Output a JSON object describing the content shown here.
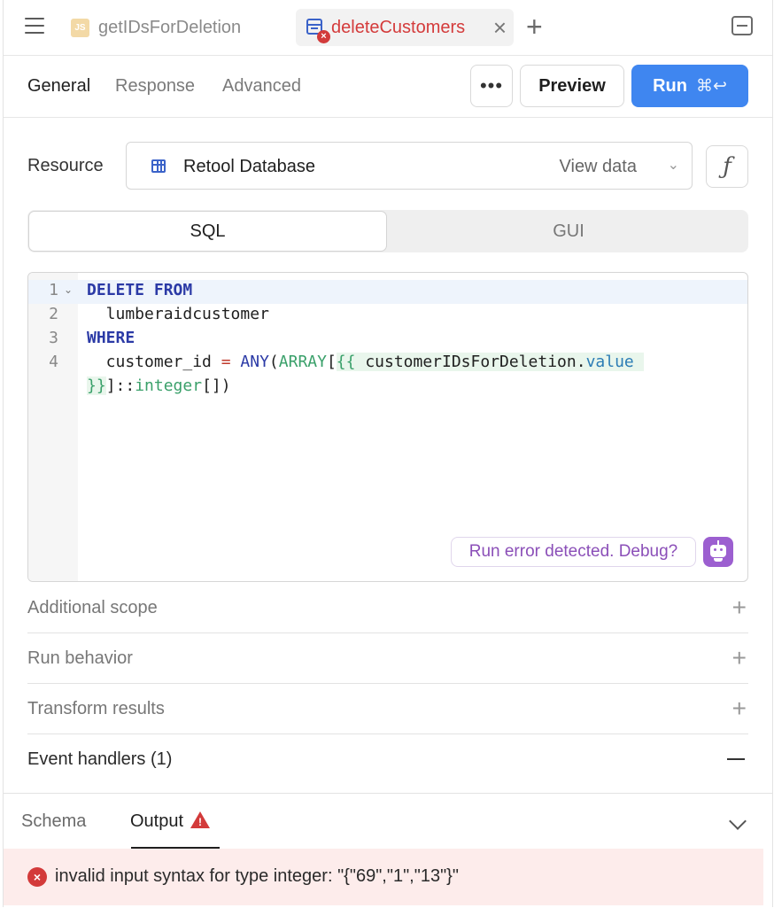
{
  "tabs": {
    "tab1": {
      "icon_text": "JS",
      "label": "getIDsForDeletion"
    },
    "tab2": {
      "label": "deleteCustomers"
    }
  },
  "subtabs": {
    "general": "General",
    "response": "Response",
    "advanced": "Advanced"
  },
  "toolbar": {
    "more": "•••",
    "preview": "Preview",
    "run": "Run",
    "run_shortcut": "⌘↩"
  },
  "resource": {
    "label": "Resource",
    "name": "Retool Database",
    "view_data": "View data",
    "fx": "ƒ"
  },
  "mode": {
    "sql": "SQL",
    "gui": "GUI"
  },
  "editor": {
    "line_numbers": [
      "1",
      "2",
      "3",
      "4"
    ],
    "lines": {
      "l1": "DELETE FROM",
      "l2": "  lumberaidcustomer",
      "l3": "WHERE",
      "l4_col": "  customer_id",
      "l4_eq": " = ",
      "l4_any": "ANY",
      "l4_open": "(",
      "l4_array": "ARRAY",
      "l4_br": "[",
      "l4_tmpl_open": "{{ ",
      "l4_var": "customerIDsForDeletion",
      "l4_dot": ".",
      "l4_prop": "value",
      "l5_tmpl_close": "}}",
      "l5_rest": "]::",
      "l5_type": "integer",
      "l5_end": "[])"
    },
    "debug": "Run error detected. Debug?"
  },
  "sections": {
    "scope": "Additional scope",
    "behavior": "Run behavior",
    "transform": "Transform results",
    "events": "Event handlers (1)"
  },
  "bottom": {
    "schema": "Schema",
    "output": "Output",
    "error": "invalid input syntax for type integer: \"{\"69\",\"1\",\"13\"}\""
  },
  "colors": {
    "accent": "#3f86f0",
    "error": "#d33a3a",
    "debug": "#9c5fd0"
  }
}
